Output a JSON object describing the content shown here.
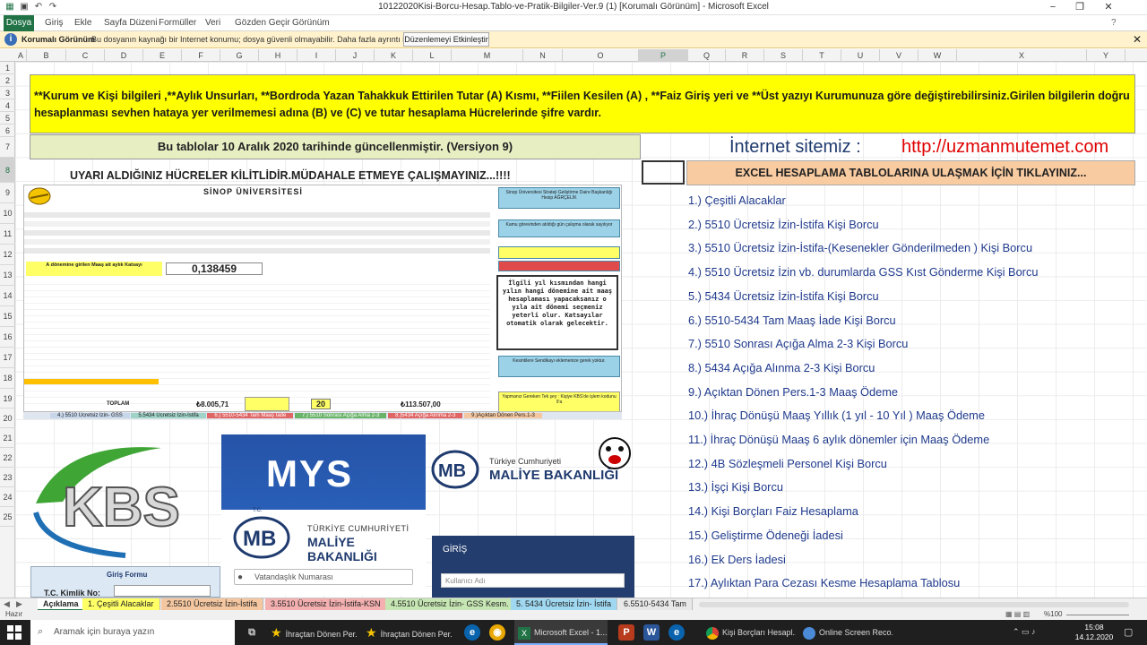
{
  "window": {
    "title": "10122020Kisi-Borcu-Hesap.Tablo-ve-Pratik-Bilgiler-Ver.9 (1)  [Korumalı Görünüm]  -  Microsoft Excel"
  },
  "ribbon": {
    "tabs": [
      "Dosya",
      "Giriş",
      "Ekle",
      "Sayfa Düzeni",
      "Formüller",
      "Veri",
      "Gözden Geçir",
      "Görünüm"
    ]
  },
  "protected_view": {
    "title": "Korumalı Görünüm",
    "message": "Bu dosyanın kaynağı bir Internet konumu; dosya güvenli olmayabilir. Daha fazla ayrıntı için tıklatın.",
    "button": "Düzenlemeyi Etkinleştir"
  },
  "columns": [
    "A",
    "B",
    "C",
    "D",
    "E",
    "F",
    "G",
    "H",
    "I",
    "J",
    "K",
    "L",
    "M",
    "N",
    "O",
    "P",
    "Q",
    "R",
    "S",
    "T",
    "U",
    "V",
    "W",
    "X",
    "Y"
  ],
  "rows": [
    "1",
    "2",
    "3",
    "4",
    "5",
    "6",
    "7",
    "8",
    "9",
    "10",
    "11",
    "12",
    "13",
    "14",
    "15",
    "16",
    "17",
    "18",
    "19",
    "20",
    "21",
    "22",
    "23",
    "24",
    "25"
  ],
  "sheet": {
    "banner": "**Kurum ve  Kişi bilgileri ,**Aylık Unsurları,  **Bordroda Yazan Tahakkuk Ettirilen Tutar (A) Kısmı, **Fiilen Kesilen (A) , **Faiz Giriş yeri ve **Üst yazıyı Kurumunuza göre değiştirebilirsiniz.Girilen bilgilerin doğru hesaplanması sevhen hataya yer verilmemesi adına  (B) ve (C) ve tutar hesaplama  Hücrelerinde  şifre vardır.",
    "updated": "Bu tablolar 10 Aralık 2020  tarihinde güncellenmiştir. (Versiyon 9)",
    "site_label": "İnternet sitemiz :",
    "site_url": "http://uzmanmutemet.com",
    "warning": "UYARI ALDIĞINIZ HÜCRELER KİLİTLİDİR.MÜDAHALE ETMEYE ÇALIŞMAYINIZ...!!!!",
    "excel_header": "EXCEL HESAPLAMA TABLOLARINA ULAŞMAK İÇİN TIKLAYINIZ...",
    "links": [
      "1.) Çeşitli Alacaklar",
      "2.) 5510 Ücretsiz İzin-İstifa Kişi Borcu",
      "3.) 5510 Ücretsiz İzin-İstifa-(Kesenekler Gönderilmeden ) Kişi Borcu",
      "4.) 5510  Ücretsiz İzin vb. durumlarda GSS Kıst Gönderme Kişi Borcu",
      "5.) 5434 Ücretsiz İzin-İstifa Kişi Borcu",
      "6.) 5510-5434 Tam Maaş İade Kişi Borcu",
      "7.) 5510 Sonrası Açığa Alma 2-3 Kişi Borcu",
      "8.) 5434 Açığa Alınma 2-3 Kişi Borcu",
      "9.) Açıktan Dönen Pers.1-3 Maaş Ödeme",
      "10.) İhraç Dönüşü Maaş Yıllık (1 yıl - 10 Yıl ) Maaş Ödeme",
      "11.) İhraç Dönüşü Maaş 6 aylık dönemler için Maaş Ödeme",
      "12.) 4B Sözleşmeli Personel Kişi Borcu",
      "13.)  İşçi Kişi Borcu",
      "14.) Kişi Borçları Faiz Hesaplama",
      "15.) Geliştirme Ödeneği İadesi",
      "16.) Ek Ders İadesi",
      "17.) Aylıktan Para Cezası Kesme Hesaplama Tablosu"
    ]
  },
  "preview": {
    "university": "SİNOP ÜNİVERSİTESİ",
    "rate_label": "A dönemine girilen Maaş ait aylık Katsayı",
    "rate_value": "0,138459",
    "side_box_1": "Sinop Üniversitesi Strateji Geliştirme Daire Başkanlığı Hesip AĞRÇELİK",
    "side_box_2": "Kamu görevinden atıldığı gün çalışma olarak sayılıyor",
    "warning_box": "İlgili yıl kısmından hangi yılın hangi dönemine ait maaş hesaplaması yapacaksanız o yıla ait dönemi seçmeniz yeterli olur. Katsayılar otomatik olarak gelecektir.",
    "side_box_3": "Kesintilere Sendikayı eklemenize gerek yoktur.",
    "side_box_4": "Yapmanız Gereken Tek şey : Kişiye KBS'de işlem kodunu 9'a",
    "total_left": "₺8.005,71",
    "total_mid": "20",
    "total_right": "₺113.507,00",
    "toplam": "TOPLAM"
  },
  "logos": {
    "kbs": "KBS",
    "mys": "MYS",
    "mb": "MB",
    "tc": "T.C.",
    "republic": "TÜRKİYE CUMHURİYETİ",
    "ministry": "MALİYE BAKANLIĞI",
    "republic2": "Türkiye Cumhuriyeti",
    "giris": "GİRİŞ",
    "username": "Kullanıcı Adı",
    "vatandaslik": "Vatandaşlık Numarası",
    "giris_form": "Giriş Formu",
    "tc_kimlik": "T.C. Kimlik No:"
  },
  "sheet_tabs": [
    "Açıklama",
    "1. Çeşitli Alacaklar",
    "2.5510 Ücretsiz İzin-İstifa",
    "3.5510 Ücretsiz İzin-İstifa-KSN",
    "4.5510 Ücretsiz İzin- GSS Kesm.",
    "5. 5434 Ücretsiz İzin- İstifa",
    "6.5510-5434 Tam"
  ],
  "status": {
    "ready": "Hazır",
    "zoom": "%100"
  },
  "taskbar": {
    "search_placeholder": "Aramak için buraya yazın",
    "apps": [
      "İhraçtan Dönen Per...",
      "İhraçtan Dönen Per...",
      "Microsoft Excel - 1...",
      "Kişi Borçları Hesapl...",
      "Online Screen Reco..."
    ],
    "time": "15:08",
    "date": "14.12.2020"
  },
  "colors": {
    "excel_green": "#217346",
    "banner_yellow": "#ffff00",
    "link_blue": "#1f3a8c",
    "url_red": "#e00000",
    "header_peach": "#f8cba1"
  }
}
